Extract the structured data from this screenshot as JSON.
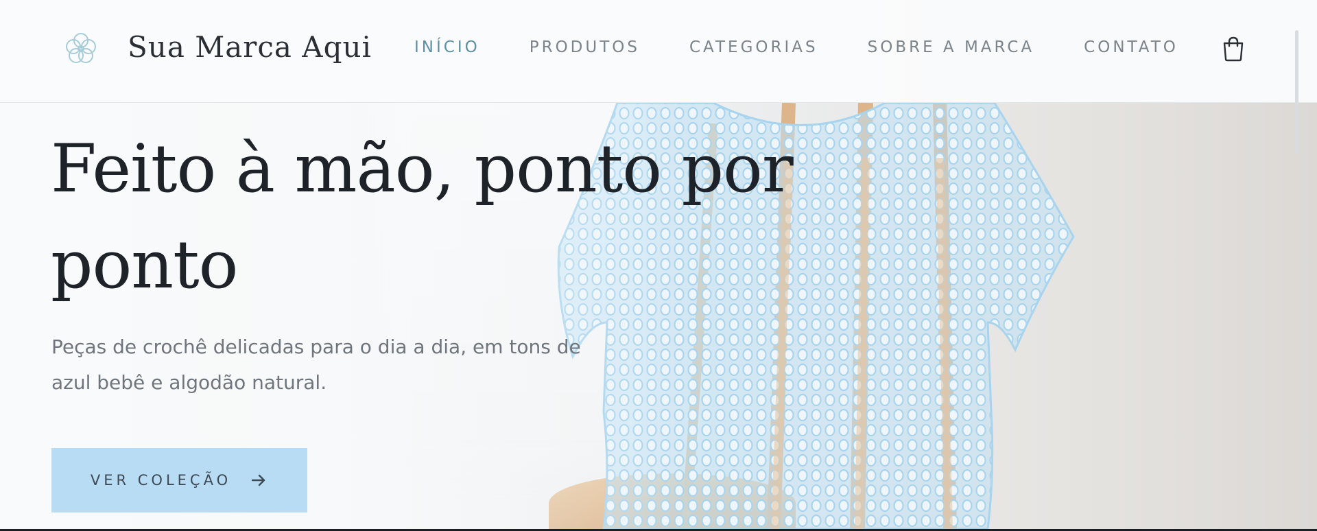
{
  "brand": {
    "name": "Sua Marca Aqui",
    "logo": "flower-icon"
  },
  "nav": {
    "items": [
      {
        "label": "INÍCIO",
        "active": true
      },
      {
        "label": "PRODUTOS",
        "active": false
      },
      {
        "label": "CATEGORIAS",
        "active": false
      },
      {
        "label": "SOBRE A MARCA",
        "active": false
      },
      {
        "label": "CONTATO",
        "active": false
      }
    ]
  },
  "cart": {
    "icon": "shopping-bag-icon"
  },
  "hero": {
    "title": "Feito à mão, ponto por ponto",
    "subtitle": "Peças de crochê delicadas para o dia a dia, em tons de azul bebê e algodão natural.",
    "cta_label": "VER COLEÇÃO",
    "cta_icon": "arrow-right-icon",
    "image": "light-blue-crochet-top-on-wooden-chair"
  },
  "colors": {
    "accent": "#b8dcf3",
    "nav_active": "#5f8fa3",
    "nav_text": "#7b848b",
    "heading": "#1e232a",
    "crochet": "#bfe2f6",
    "wood": "#deb48a"
  }
}
